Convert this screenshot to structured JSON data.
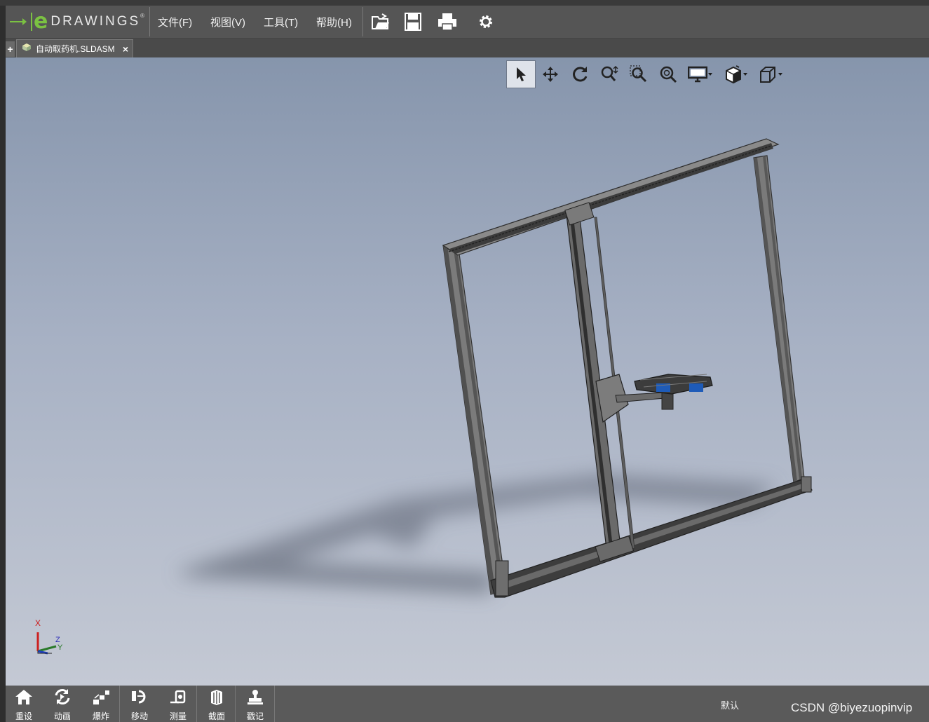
{
  "app": {
    "logo_letter": "e",
    "logo_text": "DRAWINGS",
    "logo_mark": "®"
  },
  "menu": {
    "items": [
      {
        "label": "文件(F)"
      },
      {
        "label": "视图(V)"
      },
      {
        "label": "工具(T)"
      },
      {
        "label": "帮助(H)"
      }
    ]
  },
  "toolbar": {
    "icons": [
      "open-file-icon",
      "save-icon",
      "print-icon",
      "settings-gear-icon"
    ]
  },
  "tabs": {
    "add_label": "+",
    "items": [
      {
        "label": "自动取药机.SLDASM",
        "close": "×",
        "icon": "assembly-icon"
      }
    ]
  },
  "viewport_toolbar": {
    "icons": [
      "select-arrow-icon",
      "pan-icon",
      "rotate-icon",
      "zoom-icon",
      "zoom-to-area-icon",
      "zoom-to-fit-icon",
      "display-monitor-icon",
      "view-style-icon",
      "standard-views-cube-icon"
    ],
    "active": "select-arrow-icon"
  },
  "triad": {
    "x_label": "X",
    "y_label": "Y",
    "z_label": "Z"
  },
  "colors": {
    "logo_green": "#7bc142",
    "part_blue": "#1e5bb8",
    "frame_gray": "#6e6e6e"
  },
  "bottom_toolbar": {
    "items": [
      {
        "label": "重设",
        "icon": "home-icon"
      },
      {
        "label": "动画",
        "icon": "animate-icon"
      },
      {
        "label": "爆炸",
        "icon": "explode-icon"
      },
      {
        "label": "移动",
        "icon": "move-icon"
      },
      {
        "label": "测量",
        "icon": "measure-icon"
      },
      {
        "label": "截面",
        "icon": "section-icon"
      },
      {
        "label": "戳记",
        "icon": "stamp-icon"
      }
    ],
    "status": "默认"
  },
  "watermark": "CSDN @biyezuopinvip"
}
